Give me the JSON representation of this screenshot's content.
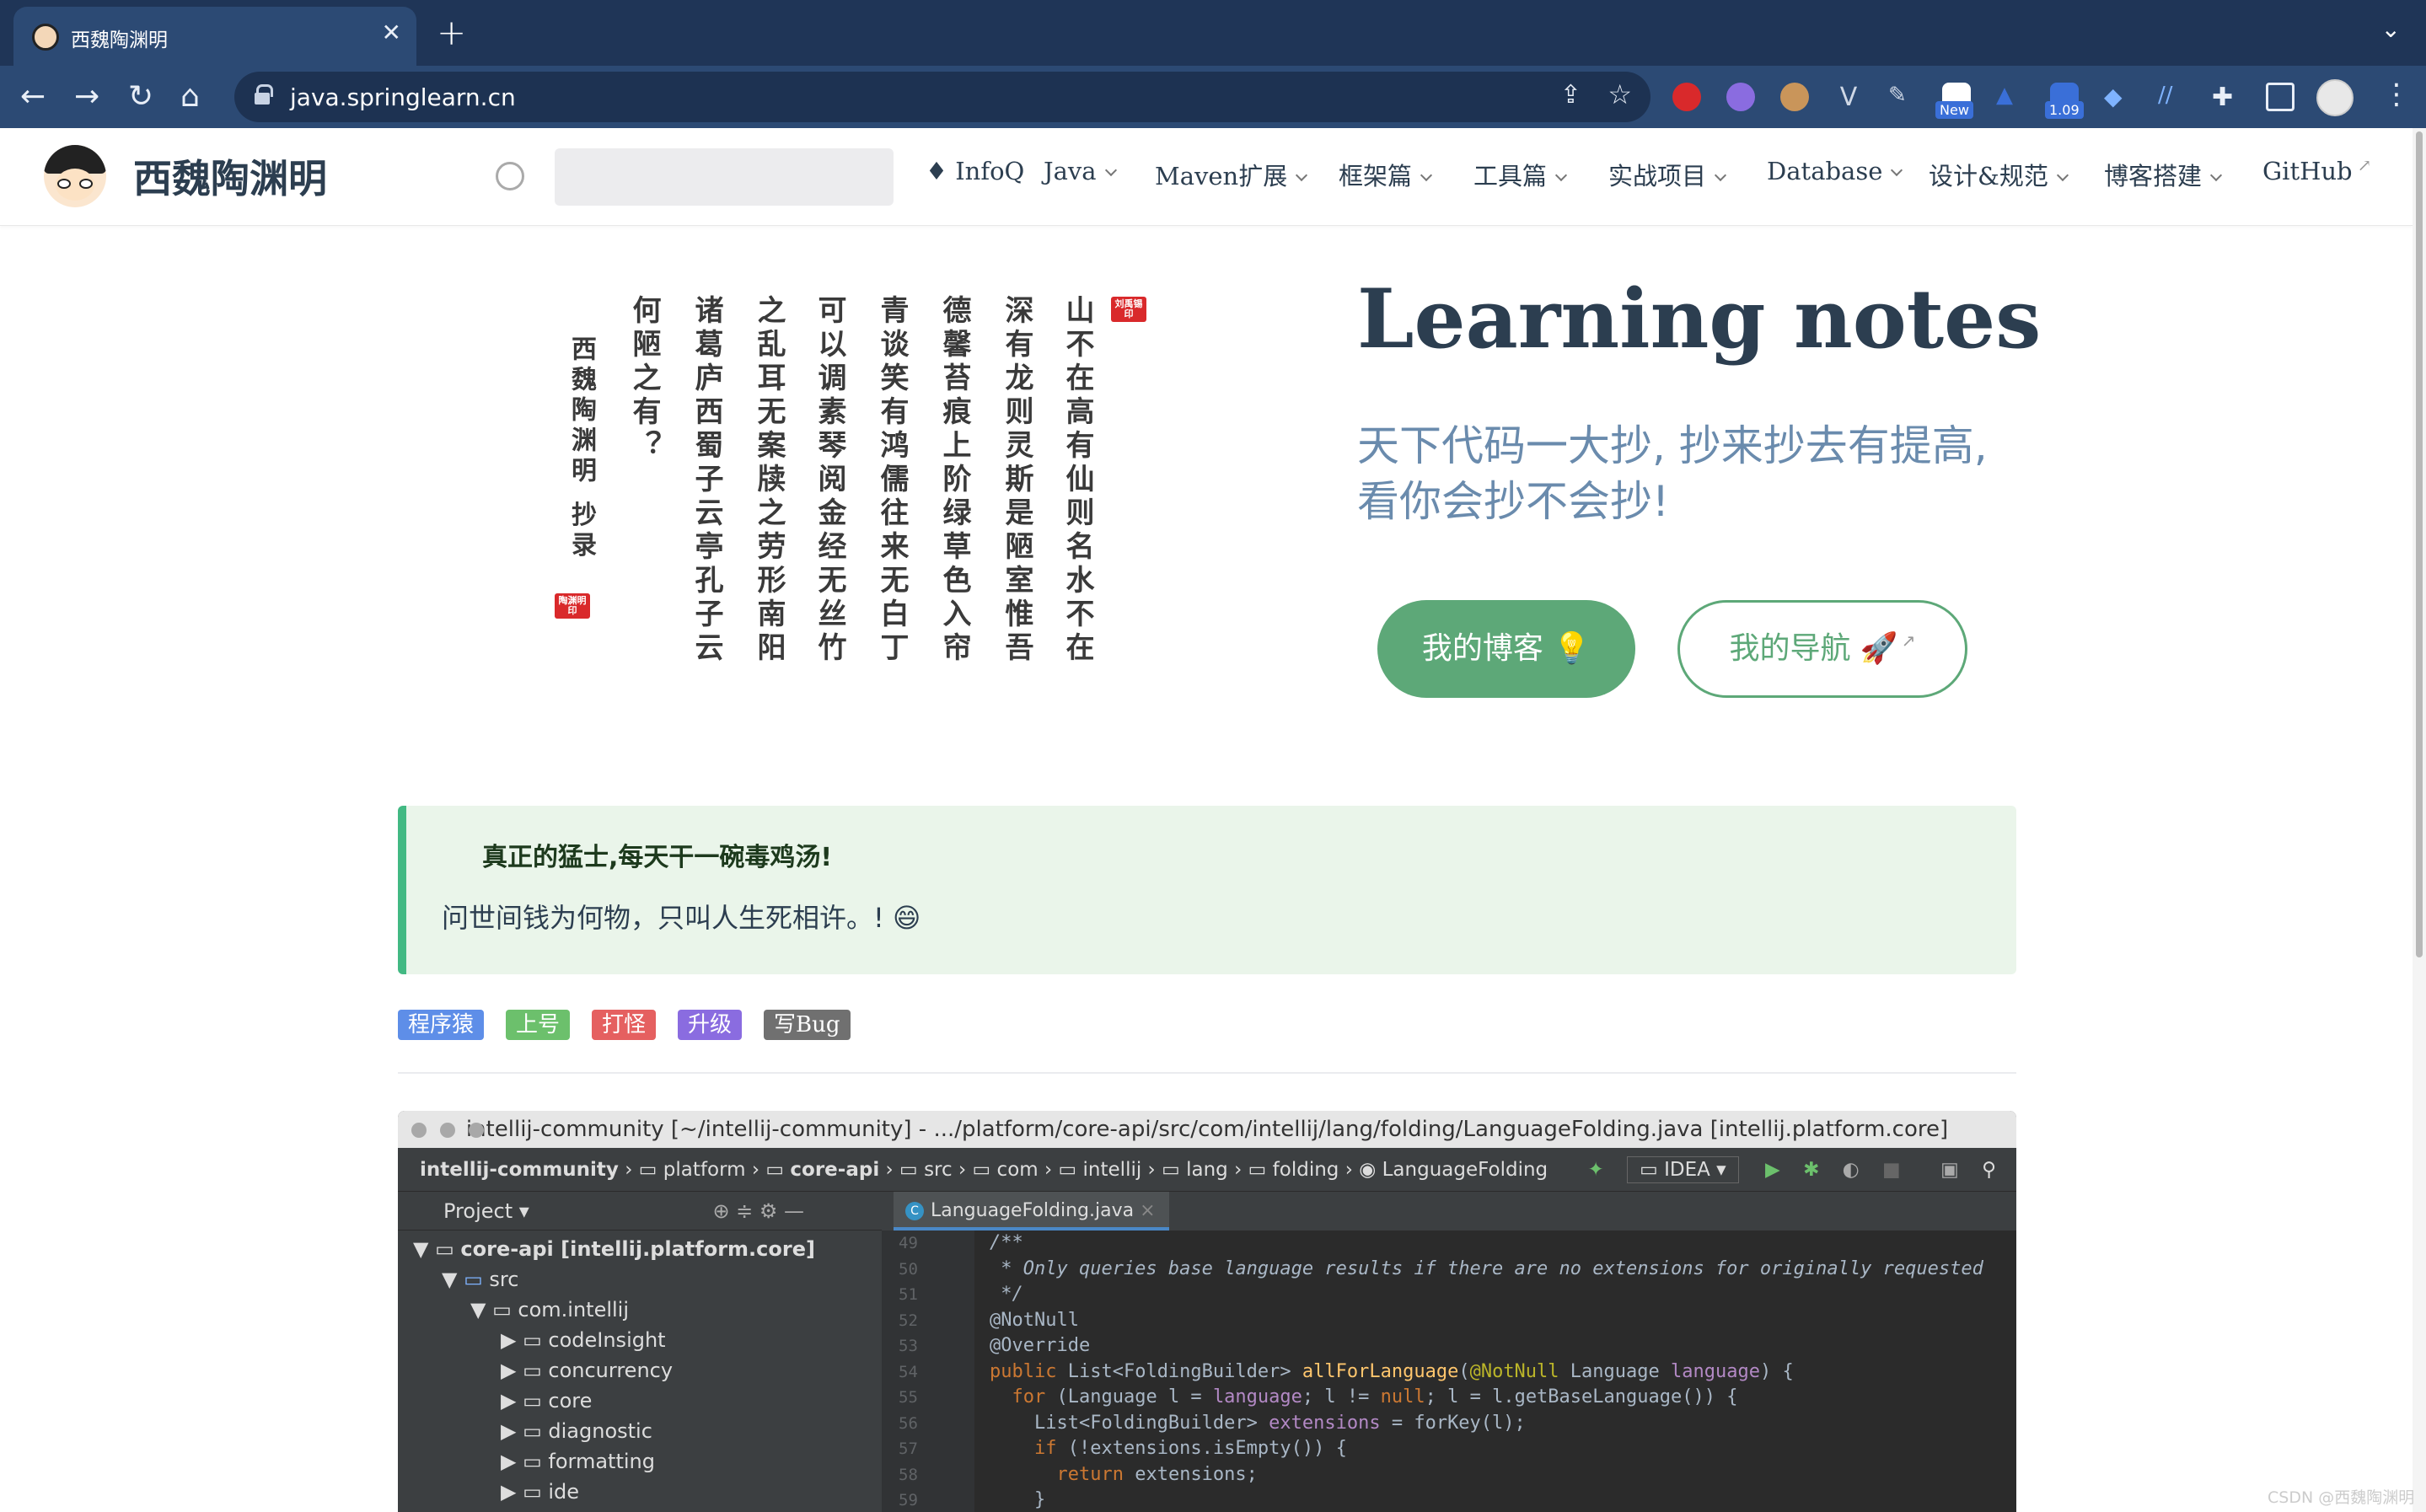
{
  "browser": {
    "tab_title": "西魏陶渊明",
    "url": "java.springlearn.cn",
    "ext_badge_new": "New",
    "ext_badge_version": "1.09"
  },
  "site": {
    "name": "西魏陶渊明",
    "nav": [
      {
        "label": "InfoQ"
      },
      {
        "label": "Java"
      },
      {
        "label": "Maven扩展"
      },
      {
        "label": "框架篇"
      },
      {
        "label": "工具篇"
      },
      {
        "label": "实战项目"
      },
      {
        "label": "Database"
      },
      {
        "label": "设计&规范"
      },
      {
        "label": "博客搭建"
      },
      {
        "label": "GitHub"
      }
    ]
  },
  "hero": {
    "poem_columns": [
      "山不在高有仙则名水不在",
      "深有龙则灵斯是陋室惟吾",
      "德馨苔痕上阶绿草色入帘",
      "青谈笑有鸿儒往来无白丁",
      "可以调素琴阅金经无丝竹",
      "之乱耳无案牍之劳形南阳",
      "诸葛庐西蜀子云亭孔子云",
      "何陋之有？",
      "西魏陶渊明 抄录"
    ],
    "seal_top": "刘禹锡印",
    "seal_bottom": "陶渊明印",
    "title": "Learning notes",
    "subtitle": "天下代码一大抄, 抄来抄去有提高, 看你会抄不会抄!",
    "primary_button": "我的博客 💡",
    "secondary_button": "我的导航 🚀"
  },
  "tip": {
    "title": "真正的猛士,每天干一碗毒鸡汤!",
    "text": "问世间钱为何物，只叫人生死相许。! 😄"
  },
  "tags": [
    {
      "label": "程序猿",
      "color": "#5e8ee8"
    },
    {
      "label": "上号",
      "color": "#6cc06c"
    },
    {
      "label": "打怪",
      "color": "#e56060"
    },
    {
      "label": "升级",
      "color": "#8a6ce0"
    },
    {
      "label": "写Bug",
      "color": "#707070"
    }
  ],
  "ide": {
    "window_title": "intellij-community [~/intellij-community] - .../platform/core-api/src/com/intellij/lang/folding/LanguageFolding.java [intellij.platform.core]",
    "breadcrumb": [
      "intellij-community",
      "platform",
      "core-api",
      "src",
      "com",
      "intellij",
      "lang",
      "folding",
      "LanguageFolding"
    ],
    "run_config": "IDEA",
    "project_label": "Project",
    "tree": [
      {
        "label": "core-api [intellij.platform.core]",
        "depth": 0
      },
      {
        "label": "src",
        "depth": 1
      },
      {
        "label": "com.intellij",
        "depth": 2
      },
      {
        "label": "codeInsight",
        "depth": 3
      },
      {
        "label": "concurrency",
        "depth": 3
      },
      {
        "label": "core",
        "depth": 3
      },
      {
        "label": "diagnostic",
        "depth": 3
      },
      {
        "label": "formatting",
        "depth": 3
      },
      {
        "label": "ide",
        "depth": 3
      }
    ],
    "tab": "LanguageFolding.java",
    "line_numbers": [
      "49",
      "50",
      "51",
      "52",
      "53",
      "54",
      "55",
      "56",
      "57",
      "58",
      "59"
    ]
  },
  "watermark": "CSDN @西魏陶渊明"
}
